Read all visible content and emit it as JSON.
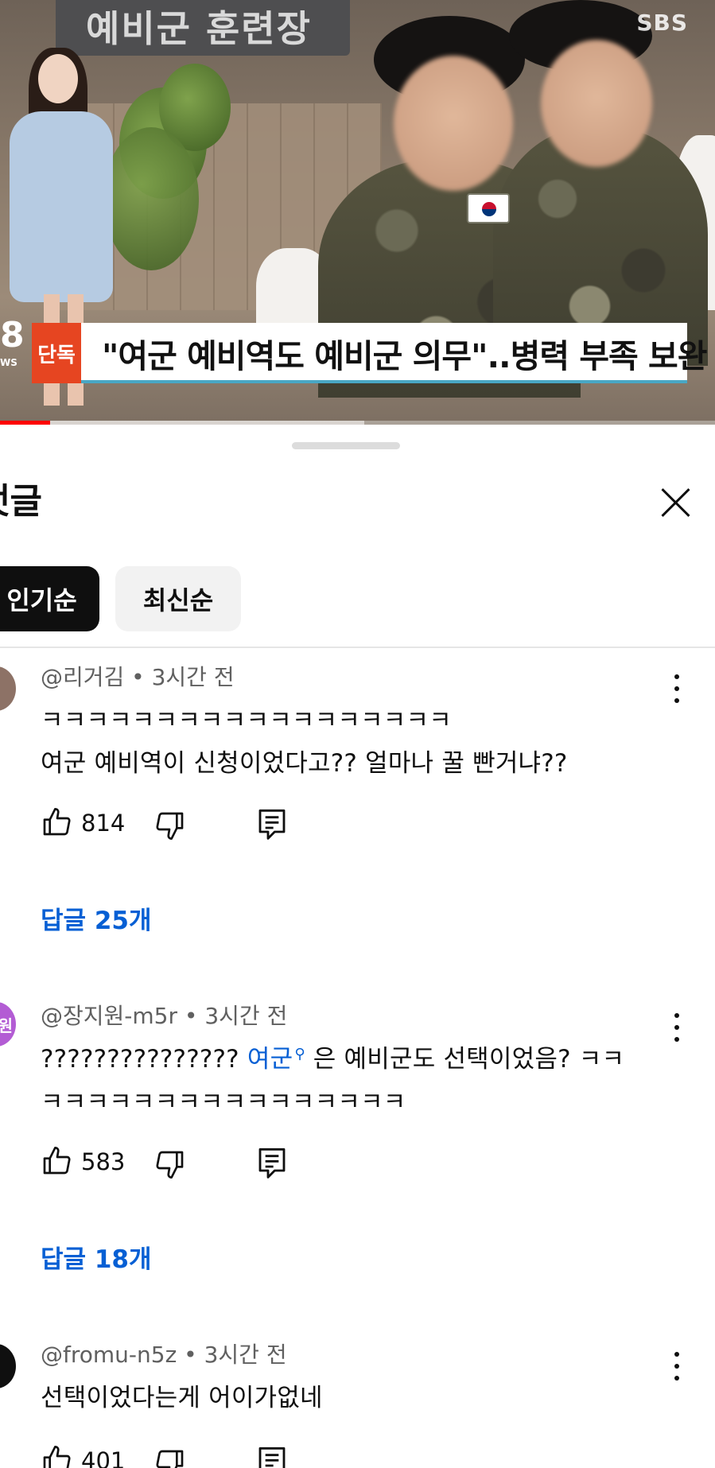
{
  "video": {
    "background_sign_text": "예비군 훈련장",
    "channel_watermark": "SBS",
    "news_logo_glyph": "8",
    "news_logo_small": "WS",
    "banner_tag": "단독",
    "banner_headline": "\"여군 예비역도 예비군 의무\"..병력 부족 보완",
    "progress": {
      "played_fraction": 0.07,
      "buffered_fraction": 0.51
    },
    "colors": {
      "banner_tag_bg": "#e64521",
      "progress_red": "#ff0000"
    }
  },
  "sheet": {
    "title": "댓글",
    "title_visible": "댓글",
    "close_icon": "close-icon",
    "sort_chips": [
      {
        "label": "인기순",
        "active": true
      },
      {
        "label": "최신순",
        "active": false
      }
    ]
  },
  "comments": [
    {
      "author": "@리거김",
      "time": "3시간 전",
      "lines": [
        "ㅋㅋㅋㅋㅋㅋㅋㅋㅋㅋㅋㅋㅋㅋㅋㅋㅋㅋ",
        "여군 예비역이 신청이었다고?? 얼마나 꿀 빤거냐??"
      ],
      "likes": "814",
      "replies_label": "답글 25개",
      "avatar_color": "#8d7266"
    },
    {
      "author": "@장지원-m5r",
      "time": "3시간 전",
      "line1_prefix": "??????????????? ",
      "line1_hashtag": "여군",
      "line1_suffix": " 은 예비군도 선택이었음? ㅋㅋ",
      "line2": "ㅋㅋㅋㅋㅋㅋㅋㅋㅋㅋㅋㅋㅋㅋㅋㅋ",
      "likes": "583",
      "replies_label": "답글 18개",
      "avatar_initial": "원",
      "avatar_color": "#b35cd4"
    },
    {
      "author": "@fromu-n5z",
      "time": "3시간 전",
      "lines": [
        "선택이었다는게 어이가없네"
      ],
      "likes": "401",
      "avatar_color": "#0f0f0f"
    }
  ],
  "separator": " • "
}
